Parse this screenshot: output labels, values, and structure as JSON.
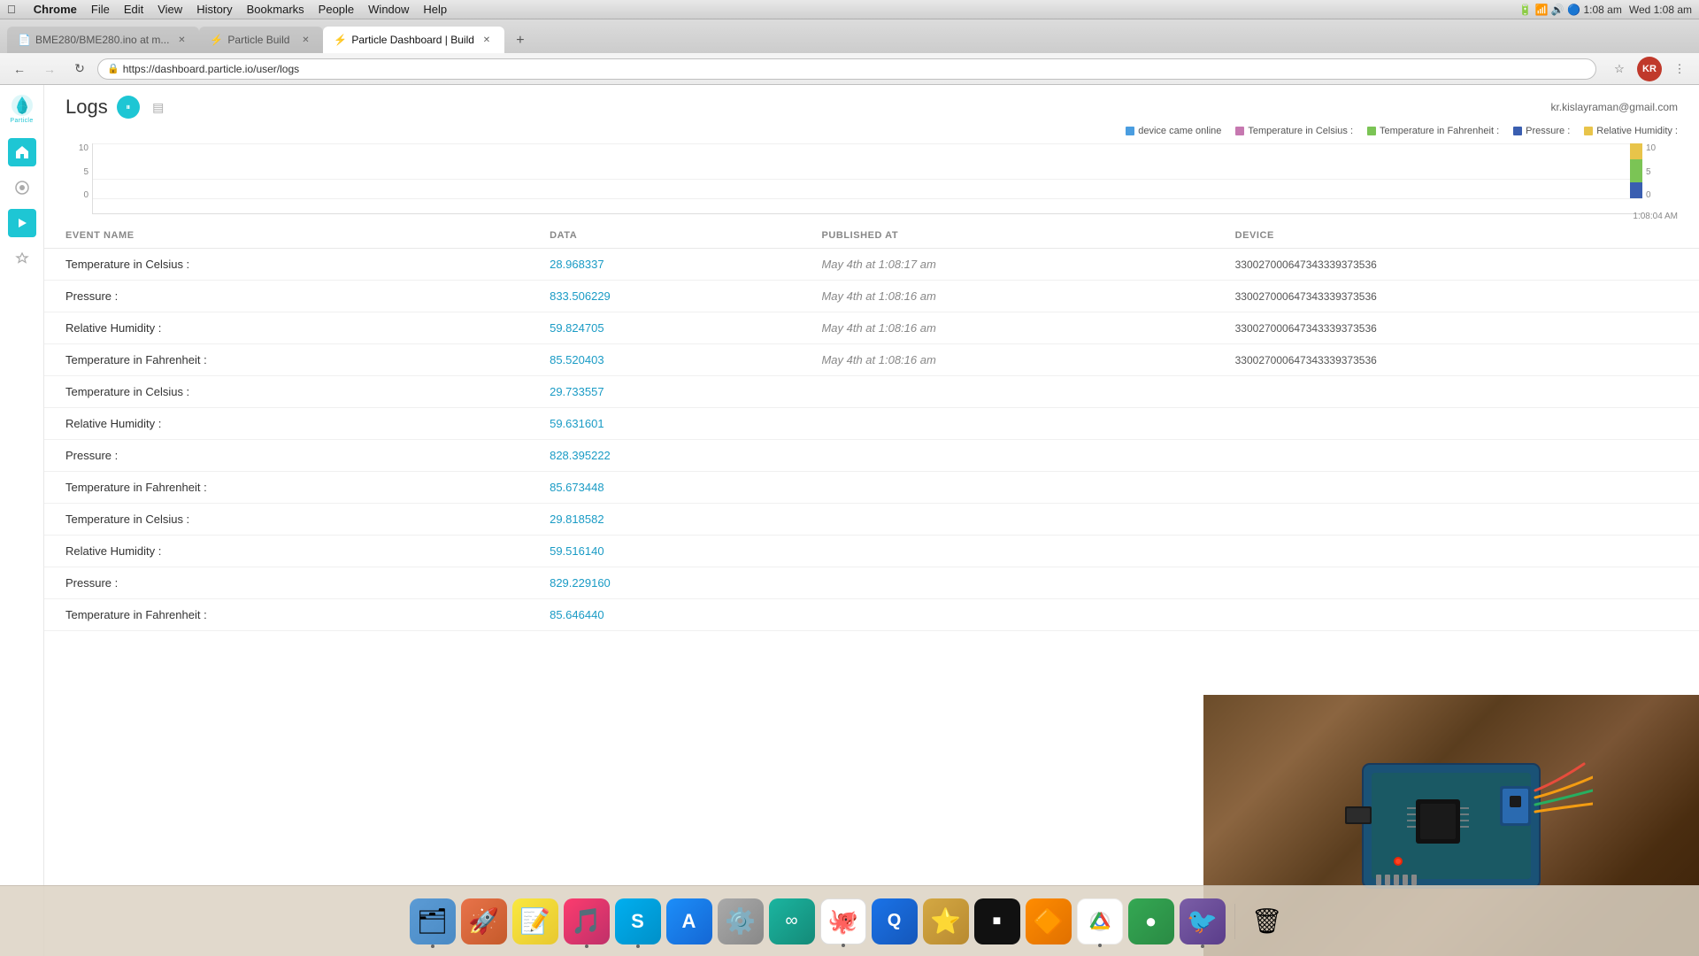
{
  "menubar": {
    "apple": "&#63743;",
    "items": [
      "Chrome",
      "File",
      "Edit",
      "View",
      "History",
      "Bookmarks",
      "People",
      "Window",
      "Help"
    ],
    "right": {
      "time": "Wed 1:08 am",
      "wifi": "WiFi",
      "battery": "Battery"
    }
  },
  "tabs": [
    {
      "id": "tab1",
      "title": "BME280/BME280.ino at m...",
      "active": false,
      "favicon": "📄"
    },
    {
      "id": "tab2",
      "title": "Particle Build",
      "active": false,
      "favicon": "⚡"
    },
    {
      "id": "tab3",
      "title": "Particle Dashboard | Build",
      "active": true,
      "favicon": "⚡"
    }
  ],
  "address_bar": {
    "url": "https://dashboard.particle.io/user/logs"
  },
  "sidebar": {
    "logo_text": "Particle",
    "items": [
      {
        "id": "home",
        "icon": "★",
        "active": true
      },
      {
        "id": "devices",
        "icon": "◉",
        "active": false
      },
      {
        "id": "console",
        "icon": "▶",
        "active": false
      },
      {
        "id": "integrations",
        "icon": "✦",
        "active": false
      }
    ]
  },
  "header": {
    "title": "Logs",
    "user_email": "kr.kislayraman@gmail.com",
    "pause_label": "⏸",
    "clear_label": "🗑"
  },
  "legend": {
    "items": [
      {
        "label": "device came online",
        "color": "#4a9de0"
      },
      {
        "label": "Temperature in Celsius :",
        "color": "#c678b0"
      },
      {
        "label": "Temperature in Fahrenheit :",
        "color": "#7bc455"
      },
      {
        "label": "Pressure :",
        "color": "#3a5eb0"
      },
      {
        "label": "Relative Humidity :",
        "color": "#e8c44a"
      }
    ]
  },
  "chart": {
    "y_labels": [
      "10",
      "5",
      "0"
    ],
    "y_right_labels": [
      "10",
      "5",
      "0"
    ],
    "time_label": "1:08:04 AM"
  },
  "table": {
    "columns": [
      "EVENT NAME",
      "DATA",
      "PUBLISHED AT",
      "DEVICE"
    ],
    "rows": [
      {
        "event": "Temperature in Celsius :",
        "data": "28.968337",
        "published_at": "May 4th at 1:08:17 am",
        "device": "330027000647343339373536"
      },
      {
        "event": "Pressure :",
        "data": "833.506229",
        "published_at": "May 4th at 1:08:16 am",
        "device": "330027000647343339373536"
      },
      {
        "event": "Relative Humidity :",
        "data": "59.824705",
        "published_at": "May 4th at 1:08:16 am",
        "device": "330027000647343339373536"
      },
      {
        "event": "Temperature in Fahrenheit :",
        "data": "85.520403",
        "published_at": "May 4th at 1:08:16 am",
        "device": "330027000647343339373536"
      },
      {
        "event": "Temperature in Celsius :",
        "data": "29.733557",
        "published_at": "",
        "device": ""
      },
      {
        "event": "Relative Humidity :",
        "data": "59.631601",
        "published_at": "",
        "device": ""
      },
      {
        "event": "Pressure :",
        "data": "828.395222",
        "published_at": "",
        "device": ""
      },
      {
        "event": "Temperature in Fahrenheit :",
        "data": "85.673448",
        "published_at": "",
        "device": ""
      },
      {
        "event": "Temperature in Celsius :",
        "data": "29.818582",
        "published_at": "",
        "device": ""
      },
      {
        "event": "Relative Humidity :",
        "data": "59.516140",
        "published_at": "",
        "device": ""
      },
      {
        "event": "Pressure :",
        "data": "829.229160",
        "published_at": "",
        "device": ""
      },
      {
        "event": "Temperature in Fahrenheit :",
        "data": "85.646440",
        "published_at": "",
        "device": ""
      }
    ]
  },
  "dock": {
    "items": [
      {
        "id": "finder",
        "emoji": "🗂",
        "color": "#5b9bd5",
        "has_dot": false
      },
      {
        "id": "launchpad",
        "emoji": "🚀",
        "color": "#e8734a",
        "has_dot": false
      },
      {
        "id": "notes",
        "emoji": "📝",
        "color": "#f5d030",
        "has_dot": false
      },
      {
        "id": "itunes",
        "emoji": "🎵",
        "color": "#fc3c6e",
        "has_dot": true
      },
      {
        "id": "skype",
        "emoji": "S",
        "color": "#00aff0",
        "has_dot": true
      },
      {
        "id": "appstore",
        "emoji": "A",
        "color": "#1c8ef9",
        "has_dot": false
      },
      {
        "id": "system-prefs",
        "emoji": "⚙",
        "color": "#888",
        "has_dot": false
      },
      {
        "id": "arduino",
        "emoji": "∞",
        "color": "#1bb5a0",
        "has_dot": false
      },
      {
        "id": "github",
        "emoji": "🐙",
        "color": "#333",
        "has_dot": true
      },
      {
        "id": "finder2",
        "emoji": "Q",
        "color": "#1a73e8",
        "has_dot": false
      },
      {
        "id": "star",
        "emoji": "★",
        "color": "#d4a843",
        "has_dot": false
      },
      {
        "id": "black",
        "emoji": "■",
        "color": "#111",
        "has_dot": false
      },
      {
        "id": "vlc",
        "emoji": "🔶",
        "color": "#ff7f00",
        "has_dot": false
      },
      {
        "id": "chrome",
        "emoji": "◉",
        "color": "#4285f4",
        "has_dot": true
      },
      {
        "id": "green",
        "emoji": "●",
        "color": "#34a853",
        "has_dot": false
      },
      {
        "id": "twitterrific",
        "emoji": "🐦",
        "color": "#1da1f2",
        "has_dot": true
      },
      {
        "id": "trash",
        "emoji": "🗑",
        "color": "#aaa",
        "has_dot": false
      }
    ]
  }
}
